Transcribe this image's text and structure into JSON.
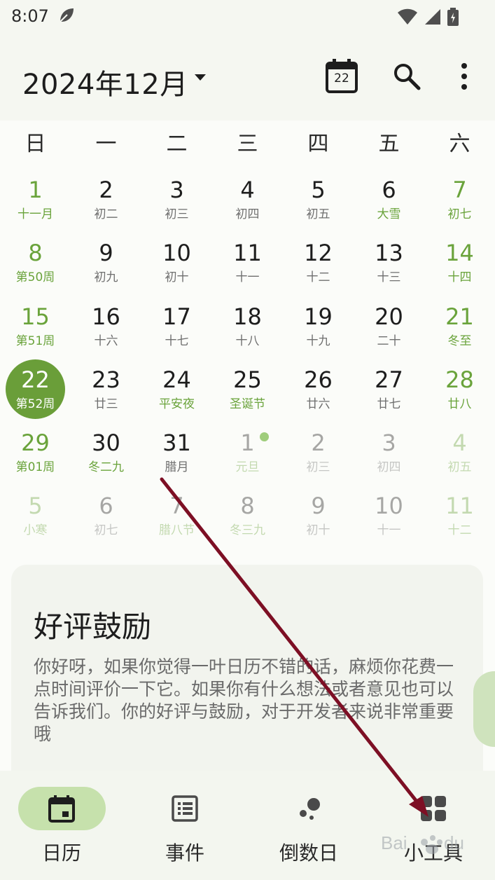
{
  "status_bar": {
    "time": "8:07"
  },
  "header": {
    "month_title": "2024年12月",
    "today_icon_day": "22"
  },
  "weekdays": [
    "日",
    "一",
    "二",
    "三",
    "四",
    "五",
    "六"
  ],
  "weeks": [
    [
      {
        "num": "1",
        "sub": "十一月"
      },
      {
        "num": "2",
        "sub": "初二"
      },
      {
        "num": "3",
        "sub": "初三"
      },
      {
        "num": "4",
        "sub": "初四"
      },
      {
        "num": "5",
        "sub": "初五"
      },
      {
        "num": "6",
        "sub": "大雪"
      },
      {
        "num": "7",
        "sub": "初七"
      }
    ],
    [
      {
        "num": "8",
        "sub": "第50周"
      },
      {
        "num": "9",
        "sub": "初九"
      },
      {
        "num": "10",
        "sub": "初十"
      },
      {
        "num": "11",
        "sub": "十一"
      },
      {
        "num": "12",
        "sub": "十二"
      },
      {
        "num": "13",
        "sub": "十三"
      },
      {
        "num": "14",
        "sub": "十四"
      }
    ],
    [
      {
        "num": "15",
        "sub": "第51周"
      },
      {
        "num": "16",
        "sub": "十六"
      },
      {
        "num": "17",
        "sub": "十七"
      },
      {
        "num": "18",
        "sub": "十八"
      },
      {
        "num": "19",
        "sub": "十九"
      },
      {
        "num": "20",
        "sub": "二十"
      },
      {
        "num": "21",
        "sub": "冬至"
      }
    ],
    [
      {
        "num": "22",
        "sub": "第52周"
      },
      {
        "num": "23",
        "sub": "廿三"
      },
      {
        "num": "24",
        "sub": "平安夜"
      },
      {
        "num": "25",
        "sub": "圣诞节"
      },
      {
        "num": "26",
        "sub": "廿六"
      },
      {
        "num": "27",
        "sub": "廿七"
      },
      {
        "num": "28",
        "sub": "廿八"
      }
    ],
    [
      {
        "num": "29",
        "sub": "第01周"
      },
      {
        "num": "30",
        "sub": "冬二九"
      },
      {
        "num": "31",
        "sub": "腊月"
      },
      {
        "num": "1",
        "sub": "元旦"
      },
      {
        "num": "2",
        "sub": "初三"
      },
      {
        "num": "3",
        "sub": "初四"
      },
      {
        "num": "4",
        "sub": "初五"
      }
    ],
    [
      {
        "num": "5",
        "sub": "小寒"
      },
      {
        "num": "6",
        "sub": "初七"
      },
      {
        "num": "7",
        "sub": "腊八节"
      },
      {
        "num": "8",
        "sub": "冬三九"
      },
      {
        "num": "9",
        "sub": "初十"
      },
      {
        "num": "10",
        "sub": "十一"
      },
      {
        "num": "11",
        "sub": "十二"
      }
    ]
  ],
  "selected_day": "22",
  "card": {
    "title": "好评鼓励",
    "body": "你好呀，如果你觉得一叶日历不错的话，麻烦你花费一点时间评价一下它。如果你有什么想法或者意见也可以告诉我们。你的好评与鼓励，对于开发者来说非常重要哦"
  },
  "nav": [
    {
      "label": "日历",
      "icon": "calendar-icon",
      "active": true
    },
    {
      "label": "事件",
      "icon": "list-icon",
      "active": false
    },
    {
      "label": "倒数日",
      "icon": "countdown-icon",
      "active": false
    },
    {
      "label": "小工具",
      "icon": "grid-icon",
      "active": false
    }
  ],
  "colors": {
    "accent": "#6a9e39",
    "accent_light": "#c6e1ac",
    "arrow": "#7d0f24"
  },
  "watermark": "Bai du 经验"
}
